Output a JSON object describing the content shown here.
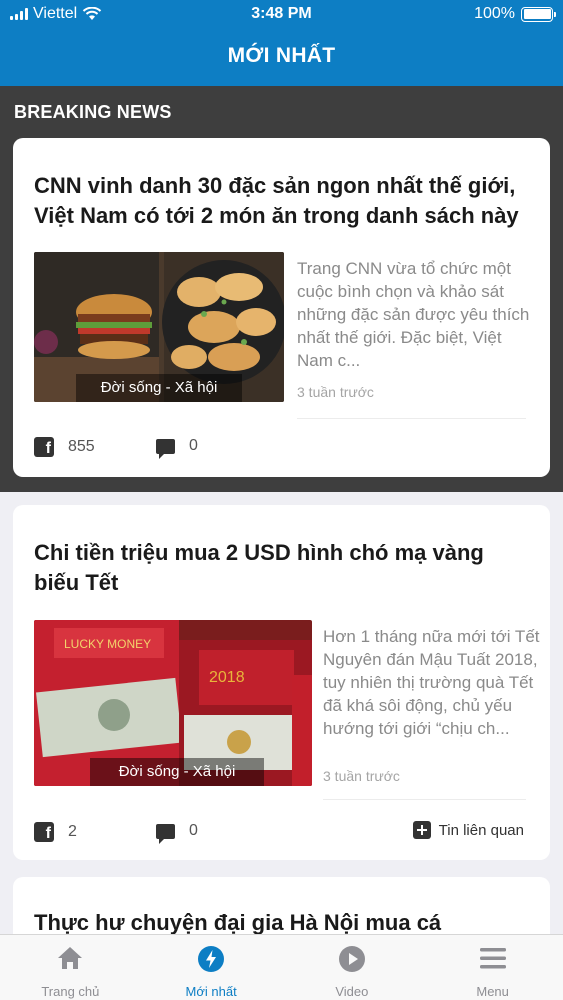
{
  "status_bar": {
    "carrier": "Viettel",
    "time": "3:48 PM",
    "battery": "100%",
    "battery_level": 1.0
  },
  "header": {
    "title": "MỚI NHẤT"
  },
  "breaking": {
    "label": "BREAKING NEWS"
  },
  "articles": [
    {
      "title": "CNN vinh danh 30 đặc sản ngon nhất thế giới, Việt Nam có tới 2 món ăn trong danh sách này",
      "category": "Đời sống - Xã hội",
      "summary": "Trang CNN vừa tổ chức một cuộc bình chọn và khảo sát những đặc sản được yêu thích nhất thế giới. Đặc biệt, Việt Nam c...",
      "time_ago": "3 tuần trước",
      "facebook_count": "855",
      "comment_count": "0"
    },
    {
      "title": "Chi tiền triệu mua 2 USD hình chó mạ vàng biếu Tết",
      "category": "Đời sống - Xã hội",
      "summary": " Hơn 1 tháng nữa mới tới Tết Nguyên đán Mậu Tuất 2018, tuy nhiên thị trường quà Tết đã khá sôi động, chủ yếu hướng tới giới “chịu ch...",
      "time_ago": "3 tuần trước",
      "facebook_count": "2",
      "comment_count": "0",
      "related_label": "Tin liên quan"
    },
    {
      "title": "Thực hư chuyện đại gia Hà Nội mua cá"
    }
  ],
  "tabs": [
    {
      "label": "Trang chủ",
      "icon": "home-icon"
    },
    {
      "label": "Mới nhất",
      "icon": "lightning-icon",
      "active": true
    },
    {
      "label": "Video",
      "icon": "play-icon"
    },
    {
      "label": "Menu",
      "icon": "menu-icon"
    }
  ],
  "colors": {
    "brand_blue": "#0d7ec4",
    "breaking_bg": "#3e3e3e"
  }
}
